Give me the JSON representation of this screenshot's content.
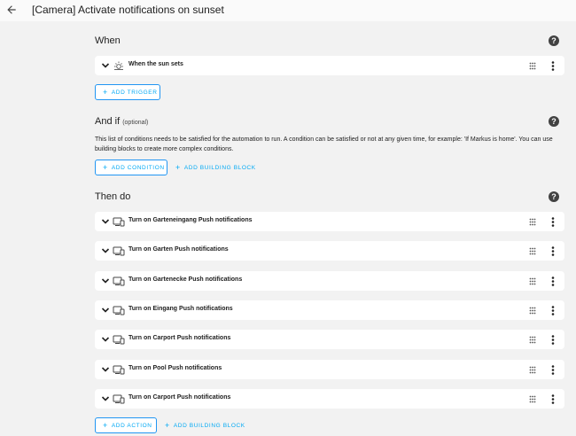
{
  "header": {
    "title": "[Camera] Activate notifications on sunset"
  },
  "when": {
    "heading": "When",
    "trigger": "When the sun sets",
    "add_trigger": "ADD TRIGGER"
  },
  "and_if": {
    "heading": "And if",
    "optional": "(optional)",
    "description": "This list of conditions needs to be satisfied for the automation to run. A condition can be satisfied or not at any given time, for example: 'If Markus is home'. You can use building blocks to create more complex conditions.",
    "add_condition": "ADD CONDITION",
    "add_building_block": "ADD BUILDING BLOCK"
  },
  "then_do": {
    "heading": "Then do",
    "actions": [
      {
        "label": "Turn on Garteneingang Push notifications"
      },
      {
        "label": "Turn on Garten Push notifications"
      },
      {
        "label": "Turn on Gartenecke Push notifications"
      },
      {
        "label": "Turn on Eingang Push notifications"
      },
      {
        "label": "Turn on Carport Push notifications"
      },
      {
        "label": "Turn on Pool Push notifications"
      },
      {
        "label": "Turn on Carport Push notifications"
      }
    ],
    "add_action": "ADD ACTION",
    "add_building_block": "ADD BUILDING BLOCK"
  },
  "icons": {
    "back": "arrow-left-icon",
    "help": "help-circle-icon",
    "trigger": "sun-icon",
    "action": "device-icon",
    "drag": "drag-handle-icon",
    "more": "more-vert-icon",
    "expand": "chevron-down-icon"
  },
  "colors": {
    "accent": "#03a9f4",
    "text": "#212121",
    "background": "#f2f2f2",
    "card": "#ffffff"
  }
}
